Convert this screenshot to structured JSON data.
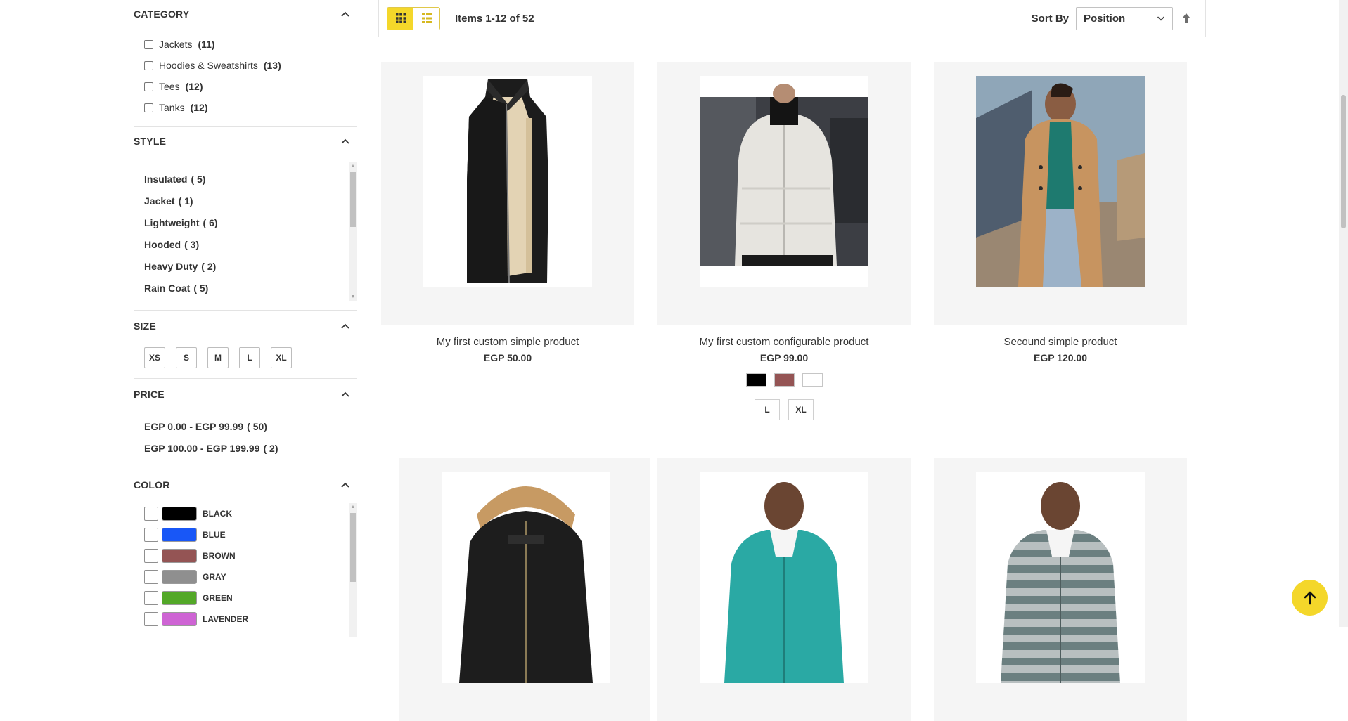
{
  "filters": {
    "category": {
      "title": "CATEGORY",
      "items": [
        {
          "label": "Jackets",
          "count": "(11)"
        },
        {
          "label": "Hoodies & Sweatshirts",
          "count": "(13)"
        },
        {
          "label": "Tees",
          "count": "(12)"
        },
        {
          "label": "Tanks",
          "count": "(12)"
        }
      ]
    },
    "style": {
      "title": "STYLE",
      "items": [
        {
          "label": "Insulated",
          "count": "( 5)"
        },
        {
          "label": "Jacket",
          "count": "( 1)"
        },
        {
          "label": "Lightweight",
          "count": "( 6)"
        },
        {
          "label": "Hooded",
          "count": "( 3)"
        },
        {
          "label": "Heavy Duty",
          "count": "( 2)"
        },
        {
          "label": "Rain Coat",
          "count": "( 5)"
        }
      ]
    },
    "size": {
      "title": "SIZE",
      "items": [
        "XS",
        "S",
        "M",
        "L",
        "XL"
      ]
    },
    "price": {
      "title": "PRICE",
      "items": [
        {
          "label": "EGP 0.00 - EGP 99.99",
          "count": "( 50)"
        },
        {
          "label": "EGP 100.00 - EGP 199.99",
          "count": "( 2)"
        }
      ]
    },
    "color": {
      "title": "COLOR",
      "items": [
        {
          "label": "BLACK",
          "hex": "#000000"
        },
        {
          "label": "BLUE",
          "hex": "#1857f7"
        },
        {
          "label": "BROWN",
          "hex": "#945454"
        },
        {
          "label": "GRAY",
          "hex": "#8f8f8f"
        },
        {
          "label": "GREEN",
          "hex": "#53a828"
        },
        {
          "label": "LAVENDER",
          "hex": "#ce64d4"
        }
      ]
    }
  },
  "toolbar": {
    "amount": "Items 1-12 of 52",
    "sort_label": "Sort By",
    "sort_value": "Position"
  },
  "products": [
    {
      "name": "My first custom simple product",
      "price": "EGP 50.00",
      "image": "black-fleece-vest"
    },
    {
      "name": "My first custom configurable product",
      "price": "EGP 99.00",
      "image": "white-puffer-jacket",
      "swatches": [
        "#000000",
        "#945454",
        "#ffffff"
      ],
      "sizes": [
        "L",
        "XL"
      ]
    },
    {
      "name": "Secound simple product",
      "price": "EGP 120.00",
      "image": "camel-overcoat"
    },
    {
      "name": "",
      "price": "",
      "image": "black-parka-fur-hood"
    },
    {
      "name": "",
      "price": "",
      "image": "teal-zip-hoodie"
    },
    {
      "name": "",
      "price": "",
      "image": "striped-gray-hoodie"
    }
  ],
  "colors": {
    "accent": "#f4d72a"
  }
}
